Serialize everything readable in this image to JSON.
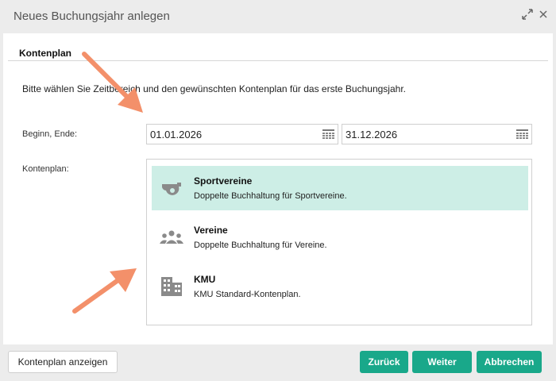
{
  "dialog": {
    "title": "Neues Buchungsjahr anlegen",
    "icons": {
      "maximize": "expand-arrows-icon",
      "close": "close-icon"
    }
  },
  "section": {
    "title": "Kontenplan",
    "intro": "Bitte wählen Sie Zeitbereich und den gewünschten Kontenplan für das erste Buchungsjahr."
  },
  "form": {
    "period_label": "Beginn, Ende:",
    "start_date": "01.01.2026",
    "end_date": "31.12.2026",
    "plan_label": "Kontenplan:"
  },
  "plans": [
    {
      "name": "Sportvereine",
      "description": "Doppelte Buchhaltung für Sportvereine.",
      "icon": "whistle-icon",
      "selected": true
    },
    {
      "name": "Vereine",
      "description": "Doppelte Buchhaltung für Vereine.",
      "icon": "group-icon",
      "selected": false
    },
    {
      "name": "KMU",
      "description": "KMU Standard-Kontenplan.",
      "icon": "building-icon",
      "selected": false
    }
  ],
  "footer": {
    "show_plan": "Kontenplan anzeigen",
    "back": "Zurück",
    "next": "Weiter",
    "cancel": "Abbrechen"
  },
  "colors": {
    "accent": "#19a88a",
    "selected_row": "#cdeee6",
    "annotation_arrow": "#f3906a"
  }
}
